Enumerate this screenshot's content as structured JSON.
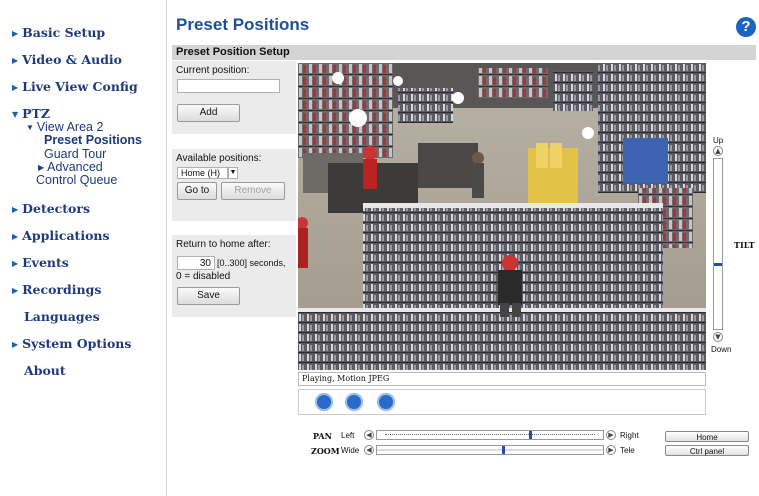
{
  "sidebar": {
    "basic_setup": "Basic Setup",
    "video_audio": "Video & Audio",
    "live_view_config": "Live View Config",
    "ptz": "PTZ",
    "view_area": "View Area 2",
    "preset_positions": "Preset Positions",
    "guard_tour": "Guard Tour",
    "advanced": "Advanced",
    "control_queue": "Control Queue",
    "detectors": "Detectors",
    "applications": "Applications",
    "events": "Events",
    "recordings": "Recordings",
    "languages": "Languages",
    "system_options": "System Options",
    "about": "About"
  },
  "header": {
    "title": "Preset Positions",
    "help": "?",
    "section": "Preset Position Setup"
  },
  "form": {
    "current_position_label": "Current position:",
    "current_position_value": "",
    "add_label": "Add",
    "available_positions_label": "Available positions:",
    "available_selected": "Home (H)",
    "goto_label": "Go to",
    "remove_label": "Remove",
    "return_home_label": "Return to home after:",
    "return_home_value": "30",
    "return_home_range": "[0..300] seconds,",
    "disabled_hint": "0 = disabled",
    "save_label": "Save"
  },
  "video": {
    "status": "Playing, Motion JPEG"
  },
  "tilt": {
    "up": "Up",
    "down": "Down",
    "label": "TILT",
    "level": 0.62
  },
  "pan": {
    "label": "PAN",
    "left": "Left",
    "right": "Right",
    "level": 0.68
  },
  "zoom": {
    "label": "ZOOM",
    "wide": "Wide",
    "tele": "Tele",
    "level": 0.56
  },
  "buttons": {
    "home": "Home",
    "ctrl_panel": "Ctrl panel"
  },
  "colors": {
    "nav_text": "#1f3a7a",
    "accent_blue": "#1c63c6",
    "panel_bg": "#ebebeb"
  }
}
